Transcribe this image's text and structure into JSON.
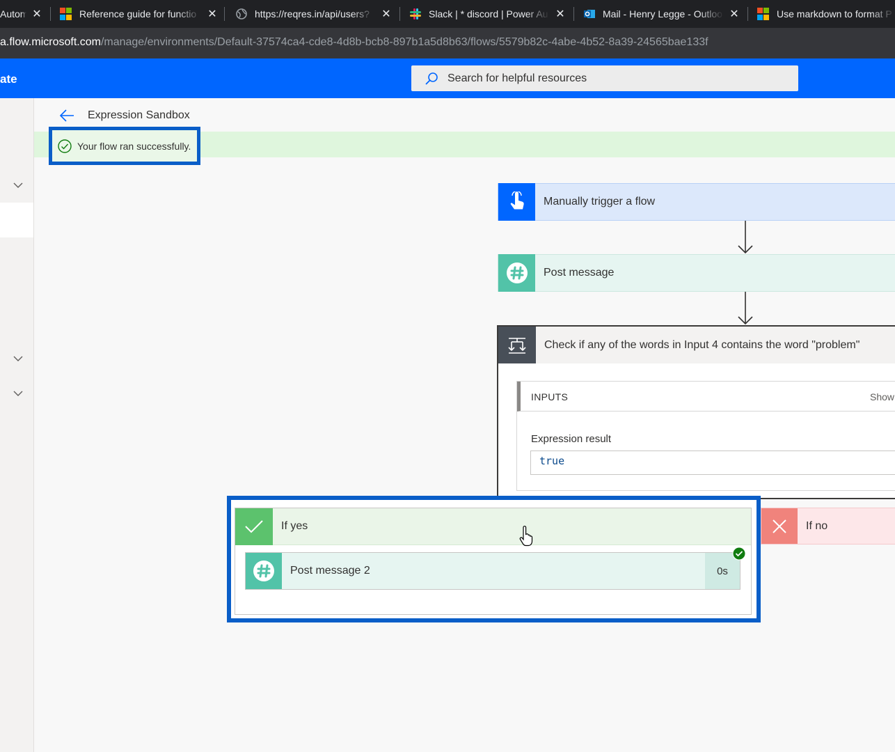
{
  "browser": {
    "tabs": [
      {
        "title": "Automa",
        "icon": "power-automate-icon"
      },
      {
        "title": "Reference guide for functio",
        "icon": "microsoft-logo-icon"
      },
      {
        "title": "https://reqres.in/api/users?",
        "icon": "globe-icon"
      },
      {
        "title": "Slack | * discord | Power Au",
        "icon": "slack-icon"
      },
      {
        "title": "Mail - Henry Legge - Outloo",
        "icon": "outlook-icon"
      },
      {
        "title": "Use markdown to format P",
        "icon": "microsoft-logo-icon"
      }
    ],
    "close_glyph": "✕",
    "url_host": "a.flow.microsoft.com",
    "url_path": "/manage/environments/Default-37574ca4-cde8-4d8b-bcb8-897b1a5d8b63/flows/5579b82c-4abe-4b52-8a39-24565bae133f"
  },
  "header": {
    "app_name": "ate",
    "search_placeholder": "Search for helpful resources",
    "color": "#0066ff"
  },
  "page": {
    "title": "Expression Sandbox",
    "status_message": "Your flow ran successfully."
  },
  "flow": {
    "trigger_label": "Manually trigger a flow",
    "post_label": "Post message",
    "condition_label": "Check if any of the words in Input 4 contains the word \"problem\"",
    "inputs_title": "INPUTS",
    "inputs_show": "Show",
    "expression_label": "Expression result",
    "expression_value": "true",
    "if_yes_label": "If yes",
    "if_no_label": "If no",
    "post2_label": "Post message 2",
    "post2_duration": "0s"
  },
  "colors": {
    "success_bg": "#dff6dd",
    "highlight_border": "#0a5ec8",
    "slack_green": "#52c3a8",
    "yes_green": "#5cc26d",
    "no_red": "#f0837c"
  }
}
